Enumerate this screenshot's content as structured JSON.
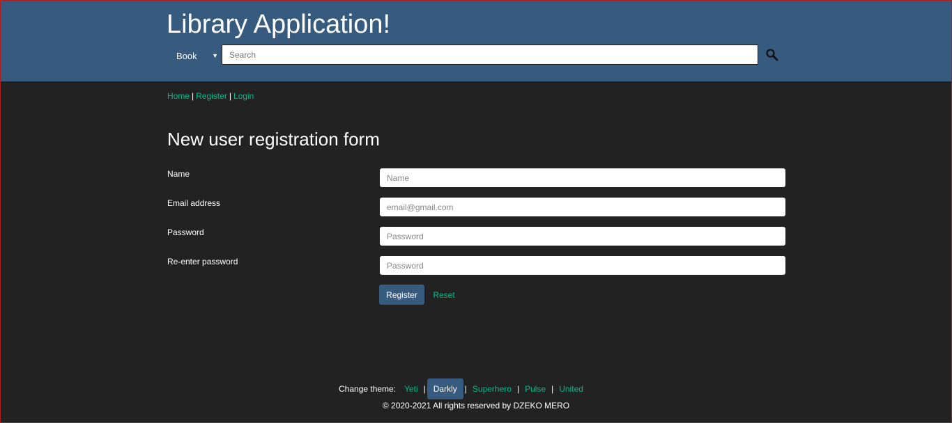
{
  "header": {
    "title": "Library Application!",
    "search_type": "Book",
    "search_placeholder": "Search"
  },
  "breadcrumb": {
    "home": "Home",
    "register": "Register",
    "login": "Login",
    "separator": "|"
  },
  "form": {
    "title": "New user registration form",
    "name_label": "Name",
    "name_placeholder": "Name",
    "email_label": "Email address",
    "email_placeholder": "email@gmail.com",
    "password_label": "Password",
    "password_placeholder": "Password",
    "repassword_label": "Re-enter password",
    "repassword_placeholder": "Password",
    "register_label": "Register",
    "reset_label": "Reset"
  },
  "footer": {
    "change_theme_label": "Change theme:",
    "themes": [
      "Yeti",
      "Darkly",
      "Superhero",
      "Pulse",
      "United"
    ],
    "active_theme": "Darkly",
    "separator": "|",
    "copyright": "© 2020-2021 All rights reserved by DZEKO MERO"
  },
  "colors": {
    "header_bg": "#375a7f",
    "body_bg": "#222222",
    "link": "#00bc8c",
    "button_bg": "#375a7f"
  },
  "icons": {
    "search": "search-icon",
    "dropdown": "caret-down-icon"
  }
}
